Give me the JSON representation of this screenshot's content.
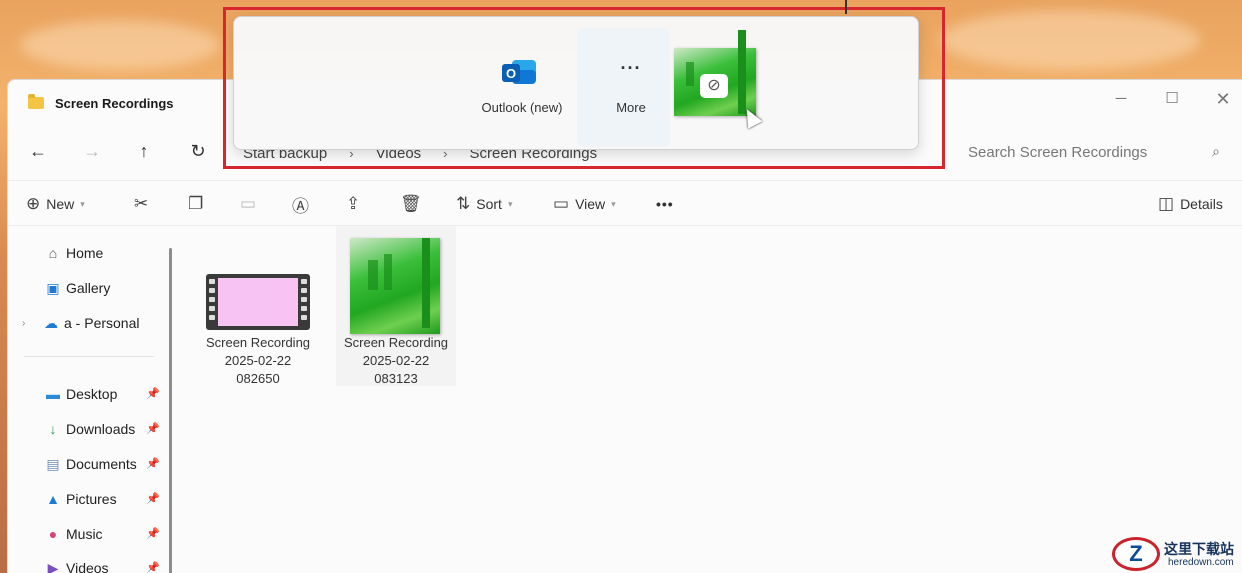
{
  "window": {
    "title": "Screen Recordings",
    "controls": [
      "minimize-icon",
      "maximize-icon",
      "close-icon"
    ]
  },
  "breadcrumb": [
    "Start backup",
    "Videos",
    "Screen Recordings"
  ],
  "search": {
    "placeholder": "Search Screen Recordings"
  },
  "toolbar": {
    "new_label": "New",
    "sort_label": "Sort",
    "view_label": "View",
    "more_label": "•••",
    "details_label": "Details"
  },
  "sidebar": {
    "items": [
      {
        "label": "Home",
        "icon": "home-icon"
      },
      {
        "label": "Gallery",
        "icon": "gallery-icon"
      },
      {
        "label": "a - Personal",
        "icon": "cloud-icon"
      }
    ],
    "pinned": [
      {
        "label": "Desktop",
        "icon": "desktop-icon"
      },
      {
        "label": "Downloads",
        "icon": "downloads-icon"
      },
      {
        "label": "Documents",
        "icon": "documents-icon"
      },
      {
        "label": "Pictures",
        "icon": "pictures-icon"
      },
      {
        "label": "Music",
        "icon": "music-icon"
      },
      {
        "label": "Videos",
        "icon": "videos-icon"
      }
    ]
  },
  "files": [
    {
      "line1": "Screen Recording",
      "line2": "2025-02-22",
      "line3": "082650"
    },
    {
      "line1": "Screen Recording",
      "line2": "2025-02-22",
      "line3": "083123"
    }
  ],
  "share": {
    "apps": [
      {
        "label": "Outlook (new)",
        "icon": "outlook-icon"
      },
      {
        "label": "More",
        "icon": "more-icon",
        "glyph": "···"
      }
    ]
  },
  "watermark": {
    "cn": "这里下载站",
    "en": "heredown.com",
    "logo": "Z"
  },
  "colors": {
    "highlight_border": "#d8262e",
    "accent": "#0f6cbd"
  }
}
